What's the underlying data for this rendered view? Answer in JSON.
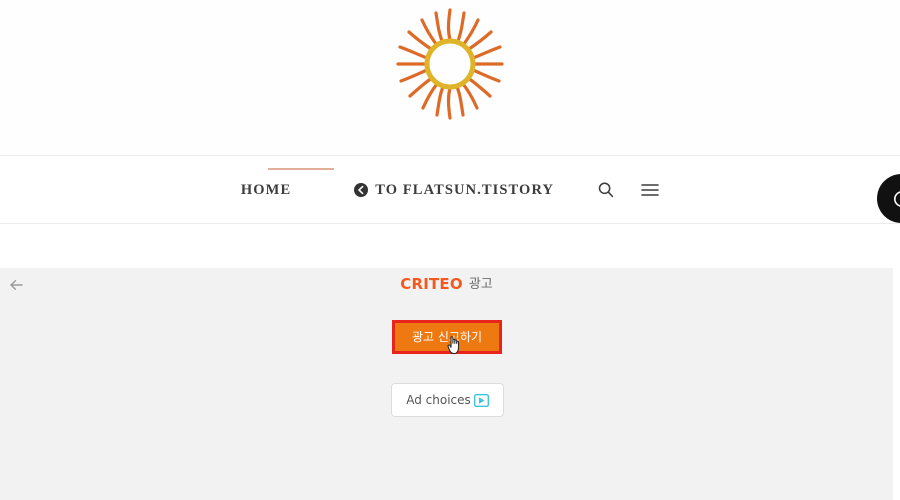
{
  "header": {
    "logo_icon": "sun-logo-icon",
    "logo_colors": {
      "rays": "#e06a28",
      "ring": "#e0b429"
    }
  },
  "nav": {
    "home_label": "HOME",
    "external_link_label": "TO FLATSUN.TISTORY",
    "external_link_icon": "arrow-circle-left-icon",
    "search_icon": "search-icon",
    "menu_icon": "hamburger-menu-icon",
    "accent_color": "#e2b09a"
  },
  "floating_button": {
    "icon": "scroll-top-icon",
    "background": "#111111"
  },
  "ad": {
    "back_arrow_icon": "arrow-left-icon",
    "brand": "CRITEO",
    "brand_color": "#f3591f",
    "brand_suffix": "광고",
    "report_button_label": "광고 신고하기",
    "report_button_fill": "#ef7911",
    "report_button_border": "#e8241c",
    "adchoices_label": "Ad choices",
    "adchoices_icon": "adchoices-triangle-icon",
    "adchoices_icon_color": "#3fc3e0",
    "panel_background": "#f2f2f2"
  },
  "cursor": {
    "icon": "pointer-hand-cursor"
  }
}
